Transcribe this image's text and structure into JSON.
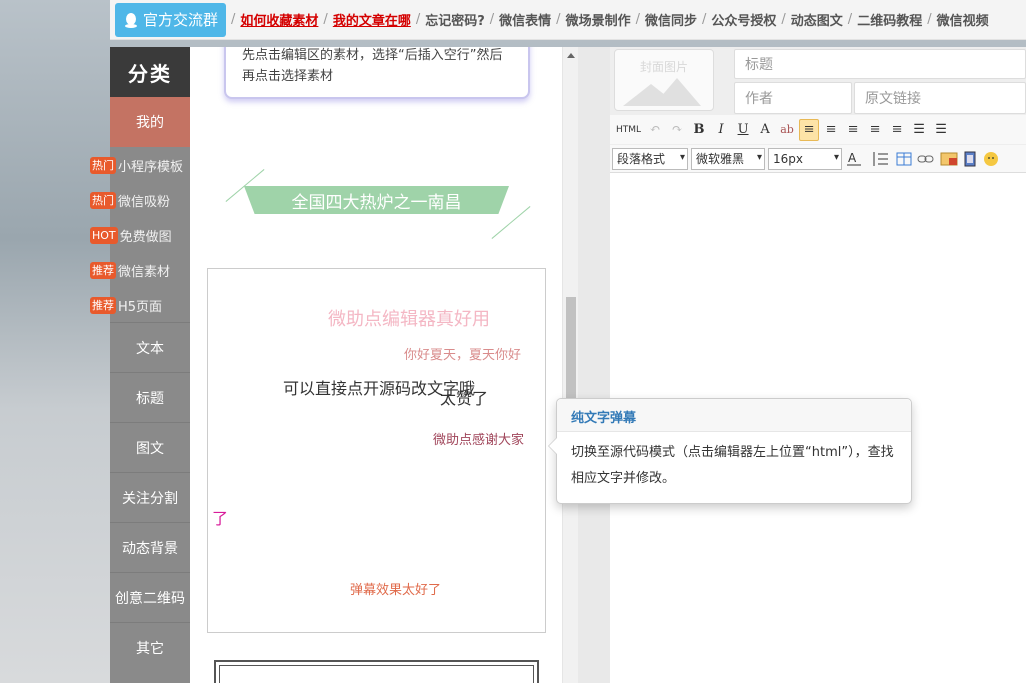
{
  "topbar": {
    "qq_button": "官方交流群",
    "links": [
      {
        "label": "如何收藏素材",
        "style": "red"
      },
      {
        "label": "我的文章在哪",
        "style": "red"
      },
      {
        "label": "忘记密码?",
        "style": "normal"
      },
      {
        "label": "微信表情",
        "style": "normal"
      },
      {
        "label": "微场景制作",
        "style": "normal"
      },
      {
        "label": "微信同步",
        "style": "normal"
      },
      {
        "label": "公众号授权",
        "style": "normal"
      },
      {
        "label": "动态图文",
        "style": "normal"
      },
      {
        "label": "二维码教程",
        "style": "normal"
      },
      {
        "label": "微信视频",
        "style": "normal"
      }
    ]
  },
  "sidebar": {
    "title": "分类",
    "my": "我的",
    "tagged_items": [
      {
        "tag": "热门",
        "label": "小程序模板"
      },
      {
        "tag": "热门",
        "label": "微信吸粉"
      },
      {
        "tag": "HOT",
        "label": "免费做图"
      },
      {
        "tag": "推荐",
        "label": "微信素材"
      },
      {
        "tag": "推荐",
        "label": "H5页面"
      }
    ],
    "items": [
      "文本",
      "标题",
      "图文",
      "关注分割",
      "动态背景",
      "创意二维码",
      "其它"
    ]
  },
  "middle": {
    "tip_text": "先点击编辑区的素材，选择“后插入空行”然后再点击选择素材",
    "banner": "全国四大热炉之一南昌",
    "danmu": [
      {
        "text": "微助点编辑器真好用",
        "color": "#f4b7c4"
      },
      {
        "text": "你好夏天，夏天你好",
        "color": "#d98c8c"
      },
      {
        "text": "可以直接点开源码改文字哦",
        "color": "#333333"
      },
      {
        "text": "太赞了",
        "color": "#333333"
      },
      {
        "text": "微助点感谢大家",
        "color": "#a0455a"
      },
      {
        "text": "了",
        "color": "#d81b9a"
      },
      {
        "text": "弹幕效果太好了",
        "color": "#e06a4a"
      }
    ]
  },
  "editor": {
    "cover_label": "封面图片",
    "title_placeholder": "标题",
    "author_placeholder": "作者",
    "source_placeholder": "原文链接",
    "toolbar1": [
      "HTML",
      "↶",
      "↷",
      "B",
      "I",
      "U",
      "A",
      "ab",
      "≡",
      "≡",
      "≡",
      "≡",
      "≡",
      "☰",
      "☰"
    ],
    "paragraph_format": "段落格式",
    "font_family": "微软雅黑",
    "font_size": "16px"
  },
  "popup": {
    "title": "纯文字弹幕",
    "body": "切换至源代码模式（点击编辑器左上位置“html”），查找相应文字并修改。"
  }
}
